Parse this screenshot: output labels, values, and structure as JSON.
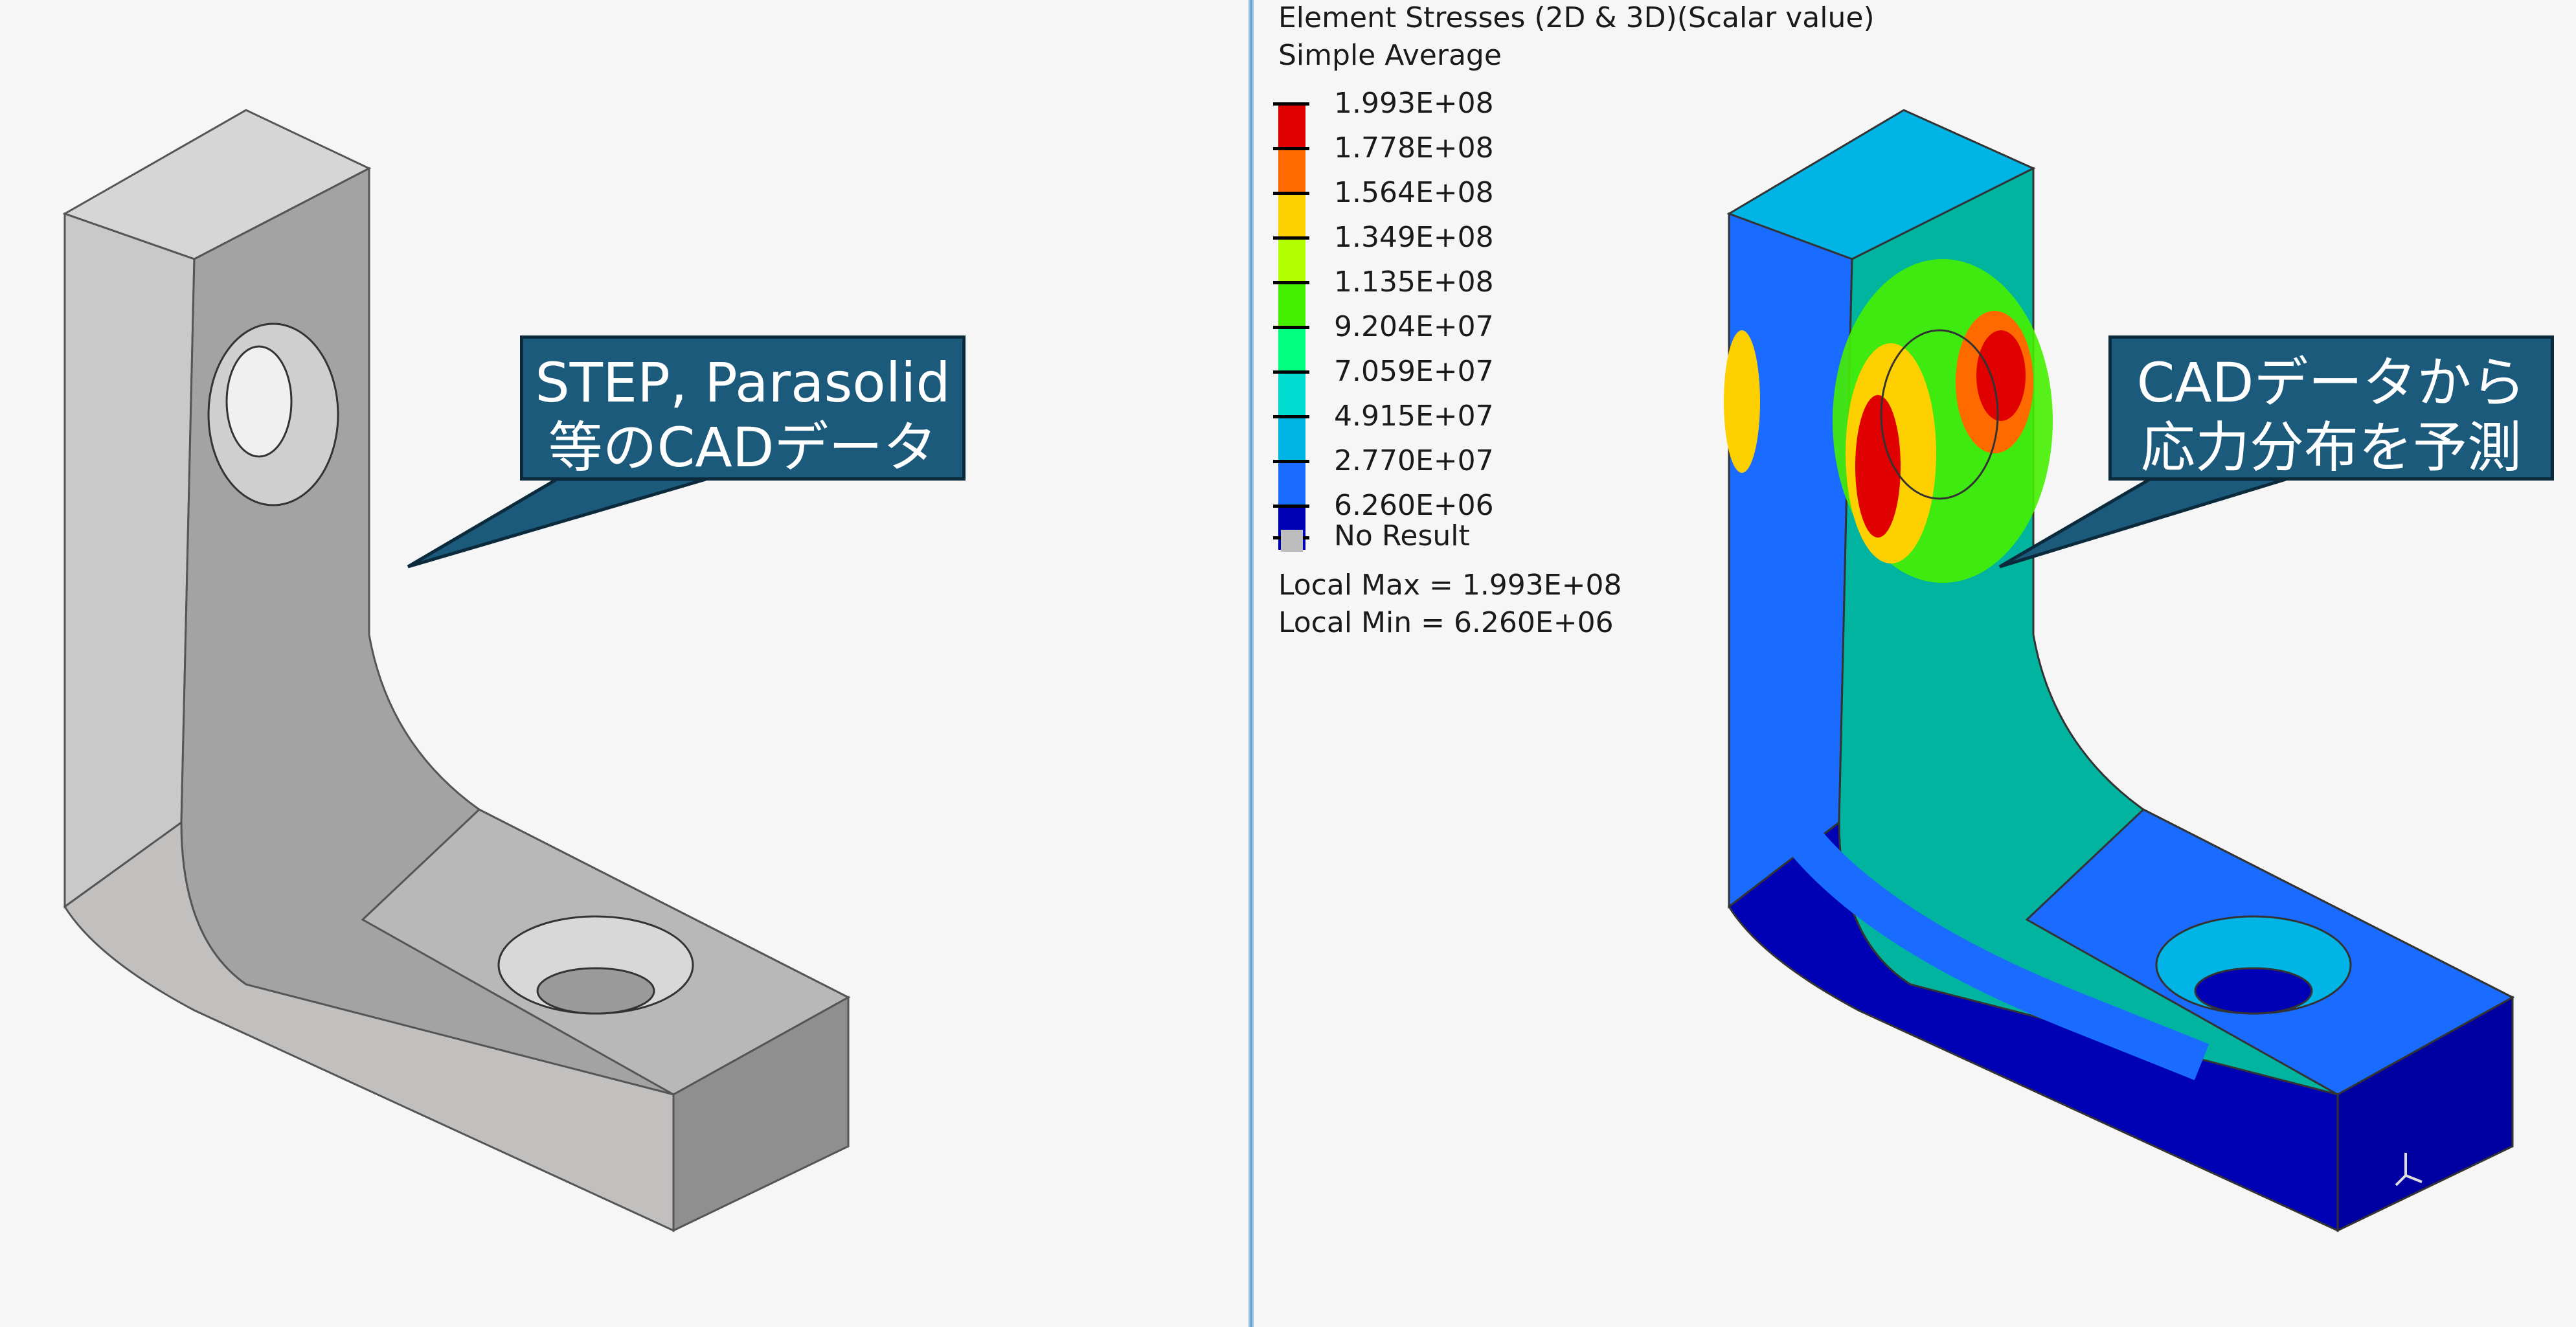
{
  "left": {
    "callout_lines": [
      "STEP, Parasolid",
      "等のCADデータ"
    ]
  },
  "right": {
    "legend": {
      "title": "Element Stresses (2D & 3D)(Scalar value)",
      "subtitle": "Simple Average",
      "levels": [
        {
          "label": "1.993E+08",
          "color": "#e00000"
        },
        {
          "label": "1.778E+08",
          "color": "#ff6a00"
        },
        {
          "label": "1.564E+08",
          "color": "#ffd000"
        },
        {
          "label": "1.349E+08",
          "color": "#b4ff00"
        },
        {
          "label": "1.135E+08",
          "color": "#46f000"
        },
        {
          "label": "9.204E+07",
          "color": "#00ff80"
        },
        {
          "label": "7.059E+07",
          "color": "#00ddd0"
        },
        {
          "label": "4.915E+07",
          "color": "#00b4e6"
        },
        {
          "label": "2.770E+07",
          "color": "#1a6bff"
        },
        {
          "label": "6.260E+06",
          "color": "#0000b4"
        }
      ],
      "no_result": {
        "label": "No Result",
        "color": "#bdbdbd"
      },
      "local_max": "Local Max =  1.993E+08",
      "local_min": "Local Min =  6.260E+06"
    },
    "callout_lines": [
      "CADデータから",
      "応力分布を予測"
    ]
  },
  "colors": {
    "callout_fill": "#1c5a7c",
    "divider": "#5c98cf",
    "background": "#f6f6f6"
  }
}
